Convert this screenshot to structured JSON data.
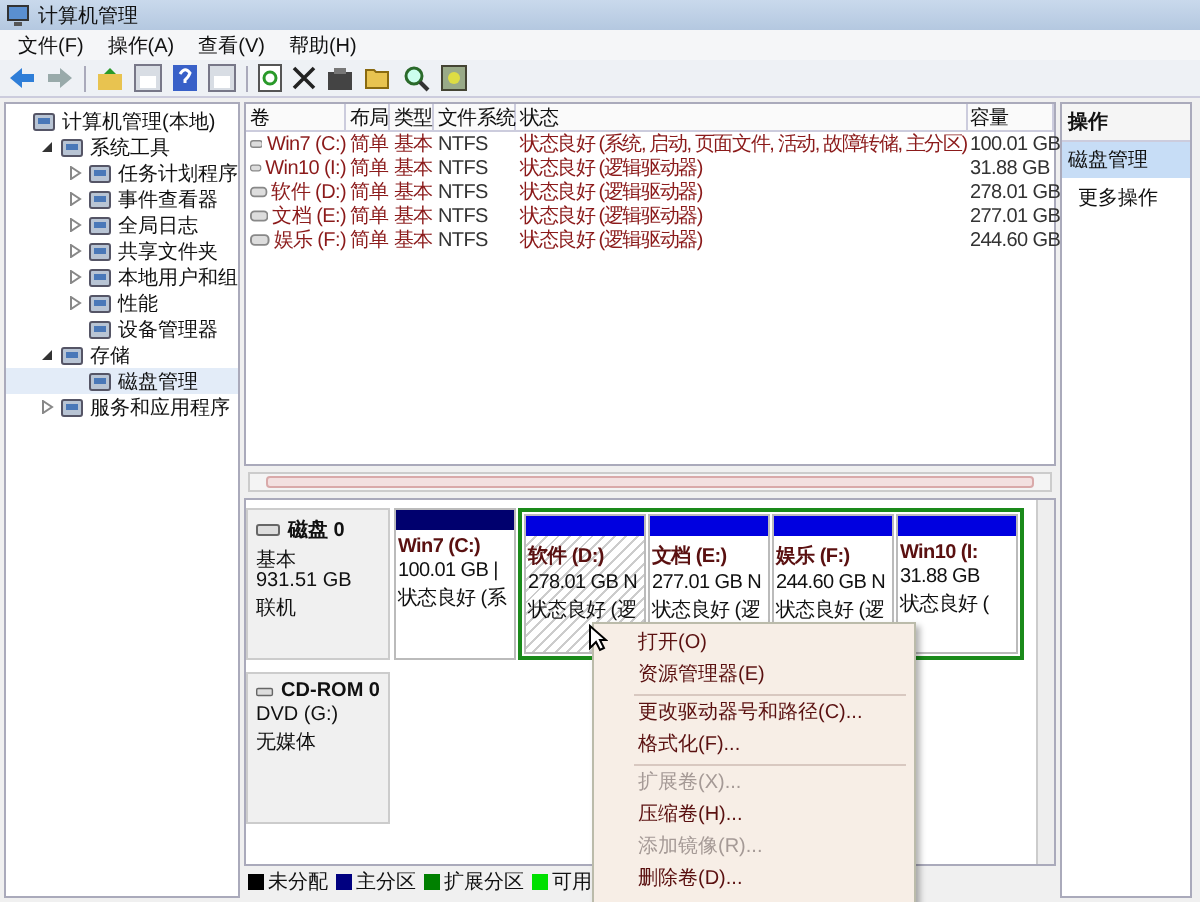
{
  "window": {
    "title": "计算机管理"
  },
  "menu": [
    "文件(F)",
    "操作(A)",
    "查看(V)",
    "帮助(H)"
  ],
  "tree": [
    {
      "label": "计算机管理(本地)",
      "selected": false,
      "children": [
        {
          "label": "系统工具",
          "expanded": true,
          "selected": false,
          "children": [
            {
              "label": "任务计划程序",
              "expanded": false,
              "selected": false
            },
            {
              "label": "事件查看器",
              "expanded": false,
              "selected": false
            },
            {
              "label": "全局日志",
              "expanded": false,
              "selected": false
            },
            {
              "label": "共享文件夹",
              "expanded": false,
              "selected": false
            },
            {
              "label": "本地用户和组",
              "expanded": false,
              "selected": false
            },
            {
              "label": "性能",
              "expanded": false,
              "selected": false
            },
            {
              "label": "设备管理器",
              "selected": false
            }
          ]
        },
        {
          "label": "存储",
          "expanded": true,
          "selected": false,
          "children": [
            {
              "label": "磁盘管理",
              "selected": true
            }
          ]
        },
        {
          "label": "服务和应用程序",
          "expanded": false,
          "selected": false
        }
      ]
    }
  ],
  "table": {
    "columns": [
      "卷",
      "布局",
      "类型",
      "文件系统",
      "状态",
      "容量"
    ],
    "rows": [
      [
        "Win7 (C:)",
        "简单",
        "基本",
        "NTFS",
        "状态良好 (系统, 启动, 页面文件, 活动, 故障转储, 主分区)",
        "100.01 GB"
      ],
      [
        "Win10 (I:)",
        "简单",
        "基本",
        "NTFS",
        "状态良好 (逻辑驱动器)",
        "31.88 GB"
      ],
      [
        "软件 (D:)",
        "简单",
        "基本",
        "NTFS",
        "状态良好 (逻辑驱动器)",
        "278.01 GB"
      ],
      [
        "文档 (E:)",
        "简单",
        "基本",
        "NTFS",
        "状态良好 (逻辑驱动器)",
        "277.01 GB"
      ],
      [
        "娱乐 (F:)",
        "简单",
        "基本",
        "NTFS",
        "状态良好 (逻辑驱动器)",
        "244.60 GB"
      ]
    ]
  },
  "disks": [
    {
      "name": "磁盘 0",
      "lines": [
        "基本",
        "931.51 GB",
        "联机"
      ],
      "partitions": [
        {
          "kind": "primary",
          "name": "Win7  (C:)",
          "size": "100.01 GB |",
          "status": "状态良好 (系",
          "selected": false
        },
        {
          "kind": "logical",
          "name": "软件  (D:)",
          "size": "278.01 GB N",
          "status": "状态良好 (逻",
          "selected": true
        },
        {
          "kind": "logical",
          "name": "文档  (E:)",
          "size": "277.01 GB N",
          "status": "状态良好 (逻",
          "selected": false
        },
        {
          "kind": "logical",
          "name": "娱乐  (F:)",
          "size": "244.60 GB N",
          "status": "状态良好 (逻",
          "selected": false
        },
        {
          "kind": "logical",
          "name": "Win10  (I:",
          "size": "31.88 GB",
          "status": "状态良好 (",
          "selected": false
        }
      ]
    },
    {
      "name": "CD-ROM 0",
      "lines": [
        "DVD (G:)",
        "无媒体"
      ]
    }
  ],
  "legend": [
    {
      "label": "未分配",
      "color": "#000000"
    },
    {
      "label": "主分区",
      "color": "#000080"
    },
    {
      "label": "扩展分区",
      "color": "#008000"
    },
    {
      "label": "可用",
      "color": "#00e000"
    }
  ],
  "actions": {
    "header": "操作",
    "section": "磁盘管理",
    "items": [
      "更多操作"
    ]
  },
  "context_menu": [
    {
      "label": "打开(O)",
      "disabled": false,
      "separator_after": false
    },
    {
      "label": "资源管理器(E)",
      "disabled": false,
      "separator_after": true
    },
    {
      "label": "更改驱动器号和路径(C)...",
      "disabled": false,
      "separator_after": false
    },
    {
      "label": "格式化(F)...",
      "disabled": false,
      "separator_after": true
    },
    {
      "label": "扩展卷(X)...",
      "disabled": true,
      "separator_after": false
    },
    {
      "label": "压缩卷(H)...",
      "disabled": false,
      "separator_after": false
    },
    {
      "label": "添加镜像(R)...",
      "disabled": true,
      "separator_after": false
    },
    {
      "label": "删除卷(D)...",
      "disabled": false,
      "separator_after": false
    }
  ]
}
